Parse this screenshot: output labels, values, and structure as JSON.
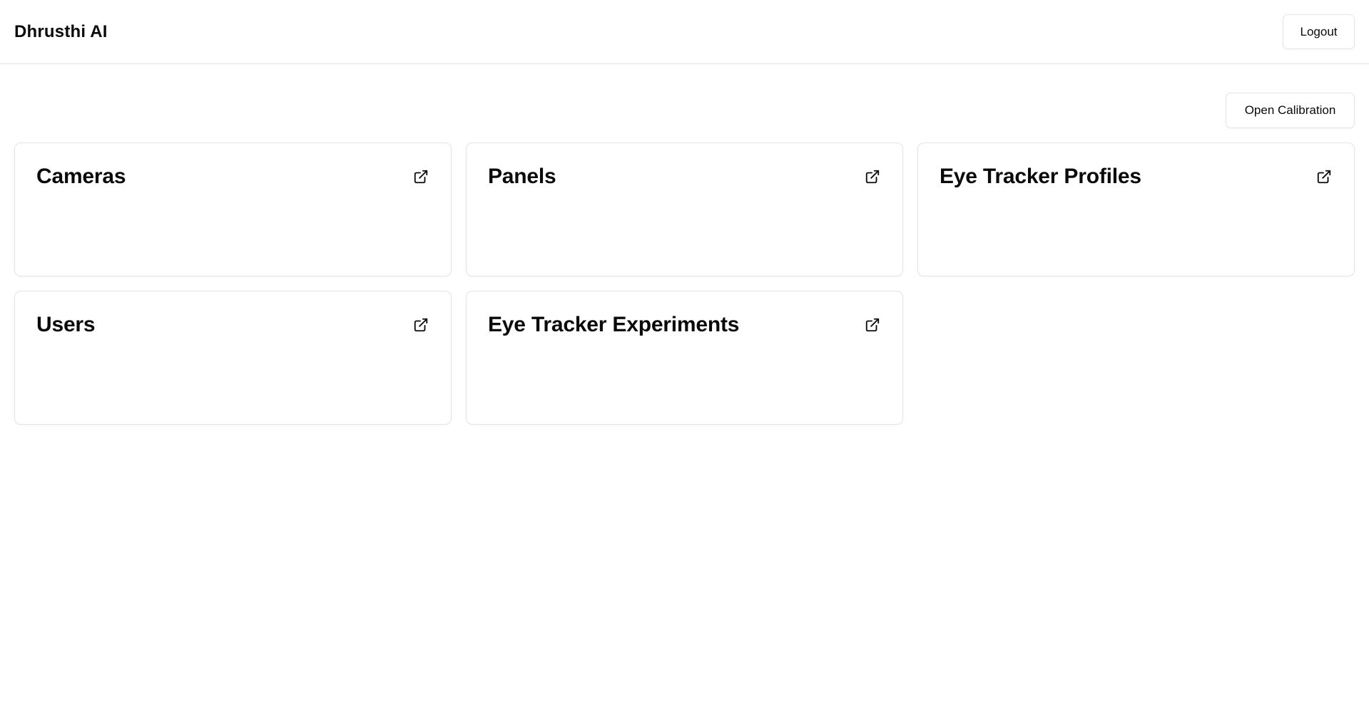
{
  "header": {
    "brand": "Dhrusthi AI",
    "logout_label": "Logout"
  },
  "toolbar": {
    "calibration_label": "Open Calibration"
  },
  "cards": [
    {
      "title": "Cameras",
      "icon": "external-link-icon"
    },
    {
      "title": "Panels",
      "icon": "external-link-icon"
    },
    {
      "title": "Eye Tracker Profiles",
      "icon": "external-link-icon"
    },
    {
      "title": "Users",
      "icon": "external-link-icon"
    },
    {
      "title": "Eye Tracker Experiments",
      "icon": "external-link-icon"
    }
  ],
  "colors": {
    "border": "#e4e4e7",
    "text": "#0a0a0a",
    "background": "#ffffff"
  }
}
